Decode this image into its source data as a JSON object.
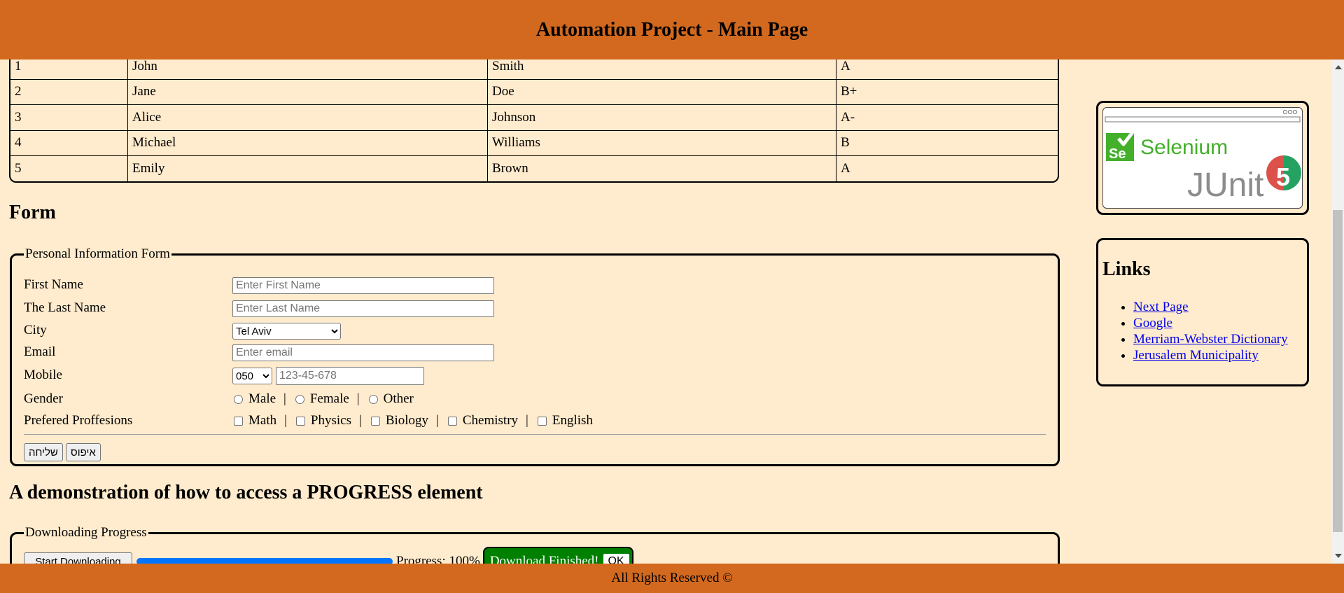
{
  "header": {
    "title": "Automation Project - Main Page"
  },
  "footer": {
    "text": "All Rights Reserved ©"
  },
  "table": {
    "rows": [
      [
        "1",
        "John",
        "Smith",
        "A"
      ],
      [
        "2",
        "Jane",
        "Doe",
        "B+"
      ],
      [
        "3",
        "Alice",
        "Johnson",
        "A-"
      ],
      [
        "4",
        "Michael",
        "Williams",
        "B"
      ],
      [
        "5",
        "Emily",
        "Brown",
        "A"
      ]
    ]
  },
  "form": {
    "title": "Form",
    "legend": "Personal Information Form",
    "first_name": {
      "label": "First Name",
      "placeholder": "Enter First Name"
    },
    "last_name": {
      "label": "The Last Name",
      "placeholder": "Enter Last Name"
    },
    "city": {
      "label": "City",
      "selected": "Tel Aviv"
    },
    "email": {
      "label": "Email",
      "placeholder": "Enter email"
    },
    "mobile": {
      "label": "Mobile",
      "prefix": "050",
      "placeholder": "123-45-678"
    },
    "gender": {
      "label": "Gender",
      "options": [
        "Male",
        "Female",
        "Other"
      ]
    },
    "professions": {
      "label": "Prefered Proffesions",
      "options": [
        "Math",
        "Physics",
        "Biology",
        "Chemistry",
        "English"
      ]
    },
    "submit_label": "שליחה",
    "reset_label": "איפוס"
  },
  "logos": {
    "selenium_text": "Selenium",
    "selenium_mark": "Se",
    "junit_text": "JUnit",
    "junit_mark": "5"
  },
  "links": {
    "title": "Links",
    "items": [
      "Next Page",
      "Google",
      "Merriam-Webster Dictionary",
      "Jerusalem Municipality"
    ]
  },
  "progress": {
    "title": "A demonstration of how to access a PROGRESS element",
    "legend": "Downloading Progress",
    "start_label": "Start Downloading",
    "value": 1.0,
    "status_text": "Progress: 100%",
    "finished_text": "Download Finished!",
    "ok_label": "OK"
  },
  "colors": {
    "header_bg": "#d2691e",
    "page_bg": "#ffebcd",
    "progress_fill": "#0075ff",
    "finished_bg": "#008000"
  }
}
